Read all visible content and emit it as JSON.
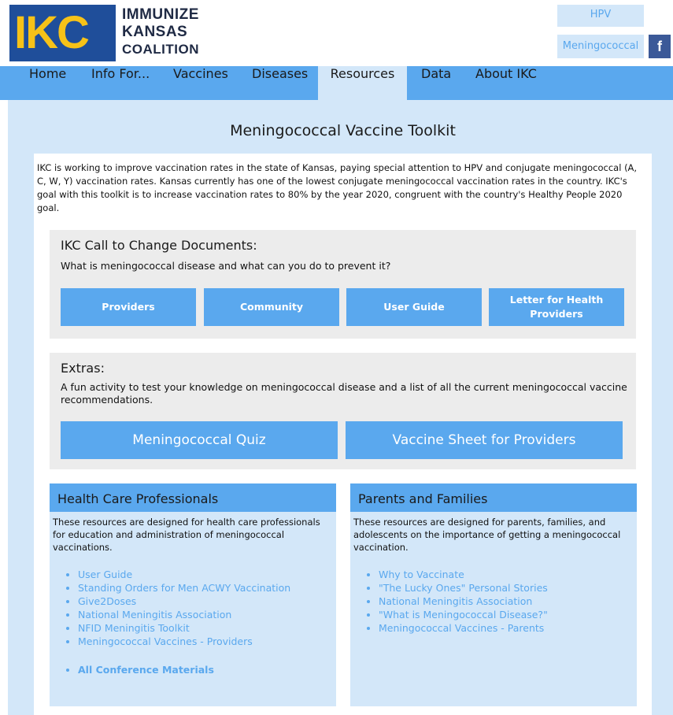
{
  "header": {
    "logo_mark": "IKC",
    "logo_line1": "IMMUNIZE",
    "logo_line2": "KANSAS",
    "logo_line3": "COALITION",
    "link_hpv": "HPV",
    "link_meningococcal": "Meningococcal",
    "facebook_glyph": "f"
  },
  "nav": {
    "items": [
      "Home",
      "Info For...",
      "Vaccines",
      "Diseases",
      "Resources",
      "Data",
      "About IKC"
    ],
    "active": "Resources"
  },
  "page": {
    "title": "Meningococcal Vaccine Toolkit",
    "intro": "IKC is working to improve vaccination rates in the state of Kansas, paying special attention to HPV and conjugate meningococcal (A, C, W, Y) vaccination rates. Kansas currently has one of the lowest conjugate meningococcal vaccination rates in the country. IKC's goal with this toolkit is to increase vaccination rates to 80% by the year 2020, congruent with the country's Healthy People 2020 goal."
  },
  "call_to_change": {
    "heading": "IKC Call to Change Documents:",
    "subtitle": "What is meningococcal disease and what can you do to prevent it?",
    "buttons": [
      "Providers",
      "Community",
      "User Guide",
      "Letter for Health Providers"
    ]
  },
  "extras": {
    "heading": "Extras:",
    "description": "A fun activity to test your knowledge on meningococcal disease and a list of all the current meningococcal vaccine recommendations.",
    "buttons": [
      "Meningococcal Quiz",
      "Vaccine Sheet for Providers"
    ]
  },
  "hcp": {
    "heading": "Health Care Professionals",
    "description": "These resources are designed for health care professionals for education and administration of meningococcal vaccinations.",
    "links": [
      "User Guide",
      "Standing Orders for Men ACWY Vaccination",
      "Give2Doses",
      "National Meningitis Association",
      "NFID Meningitis Toolkit",
      "Meningococcal Vaccines - Providers"
    ],
    "extra_link": "All Conference Materials"
  },
  "parents": {
    "heading": "Parents and Families",
    "description": "These resources are designed for parents, families, and adolescents on the importance of getting a meningococcal vaccination.",
    "links": [
      "Why to Vaccinate",
      "\"The Lucky Ones\" Personal Stories",
      "National Meningitis Association",
      "\"What is Meningococcal Disease?\"",
      "Meningococcal Vaccines - Parents"
    ]
  },
  "colors": {
    "accent_blue": "#5aa8ee",
    "light_blue": "#d3e7f9",
    "panel_gray": "#ececec",
    "logo_navy": "#1f4e9a",
    "logo_yellow": "#f6c218",
    "facebook": "#3b5998"
  }
}
